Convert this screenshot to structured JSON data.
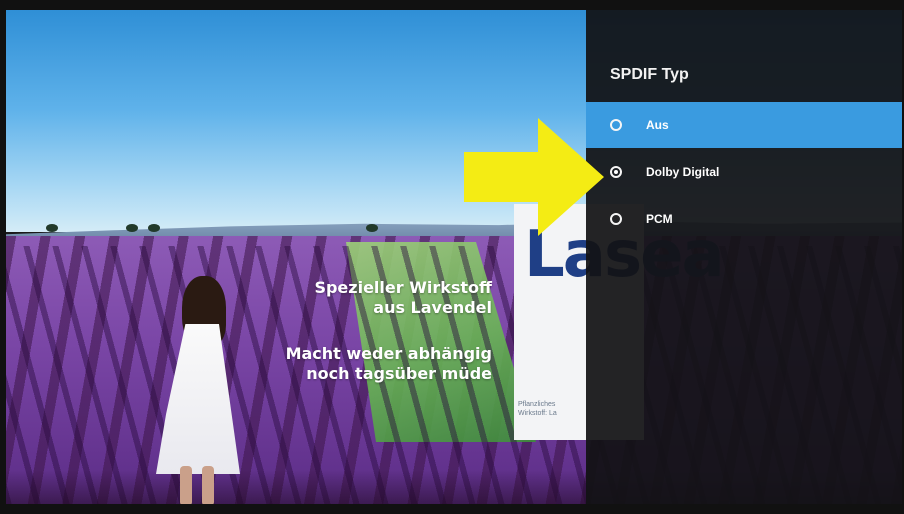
{
  "ad": {
    "line1a": "Spezieller Wirkstoff",
    "line1b": "aus Lavendel",
    "line2a": "Macht weder abhängig",
    "line2b": "noch tagsüber müde",
    "product_logo": "Lasea",
    "product_fine_1": "Pflanzliches",
    "product_fine_2": "Wirkstoff: La"
  },
  "menu": {
    "title": "SPDIF Typ",
    "options": [
      {
        "label": "Aus",
        "state": "focused"
      },
      {
        "label": "Dolby Digital",
        "state": "selected"
      },
      {
        "label": "PCM",
        "state": "unselected"
      }
    ]
  },
  "colors": {
    "focus_highlight": "#3a9be0",
    "panel_background": "#121214",
    "annotation_arrow": "#f4ec14"
  },
  "icons": {
    "radio": "radio-button-icon",
    "annotation": "yellow-arrow-icon"
  }
}
